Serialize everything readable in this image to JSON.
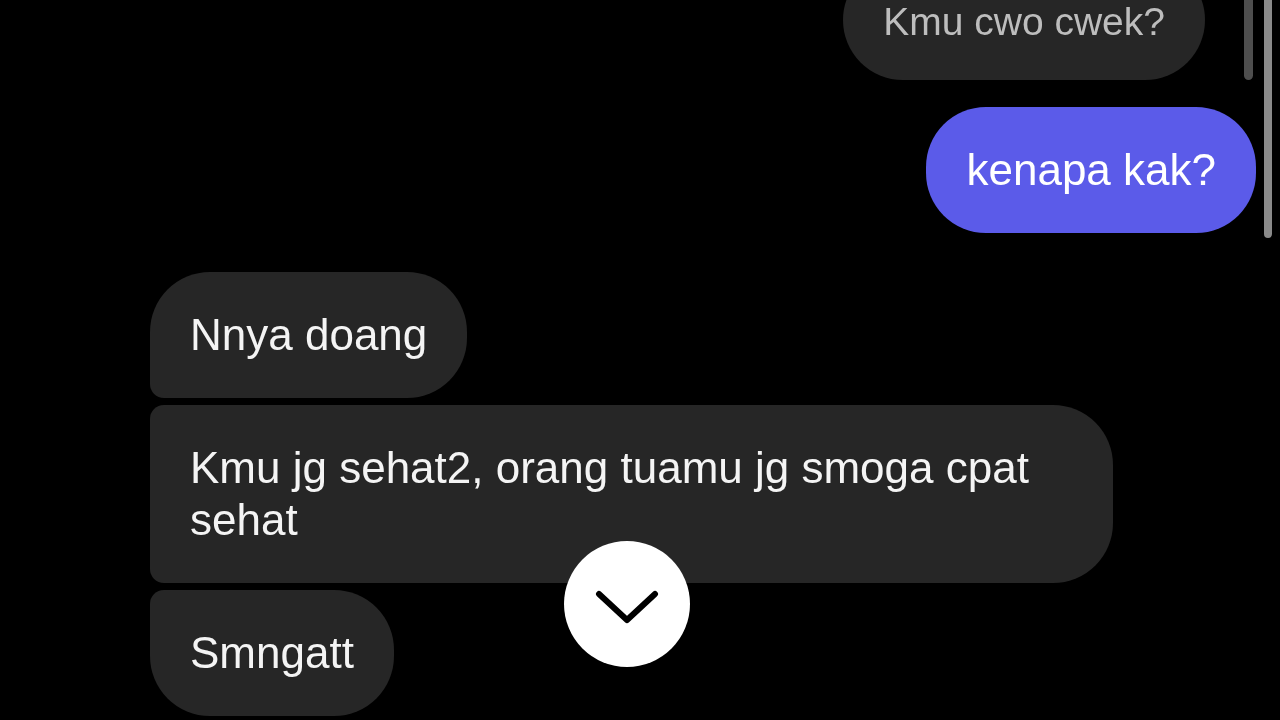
{
  "messages": [
    {
      "kind": "reply_quote",
      "text": "Kmu cwo cwek?"
    },
    {
      "kind": "sent",
      "text": "kenapa kak?"
    },
    {
      "kind": "received",
      "text": "Nnya doang"
    },
    {
      "kind": "received",
      "text": "Kmu jg sehat2, orang tuamu jg smoga cpat sehat"
    },
    {
      "kind": "received",
      "text": "Smngatt"
    }
  ]
}
